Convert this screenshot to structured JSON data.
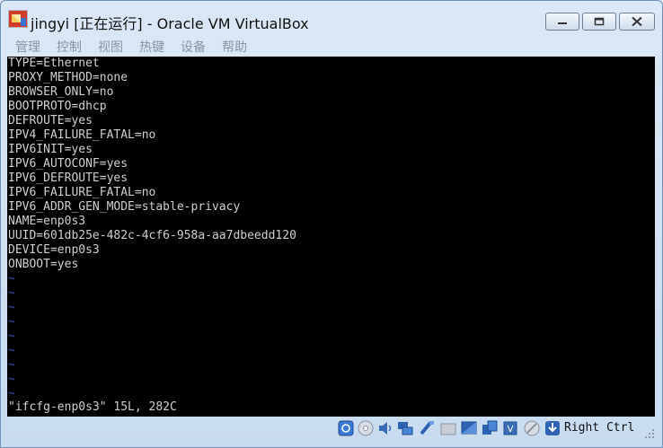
{
  "window": {
    "title": "jingyi [正在运行] - Oracle VM VirtualBox"
  },
  "menu": [
    {
      "label": "管理"
    },
    {
      "label": "控制"
    },
    {
      "label": "视图"
    },
    {
      "label": "热键"
    },
    {
      "label": "设备"
    },
    {
      "label": "帮助"
    }
  ],
  "terminal": {
    "lines": [
      "TYPE=Ethernet",
      "PROXY_METHOD=none",
      "BROWSER_ONLY=no",
      "BOOTPROTO=dhcp",
      "DEFROUTE=yes",
      "IPV4_FAILURE_FATAL=no",
      "IPV6INIT=yes",
      "IPV6_AUTOCONF=yes",
      "IPV6_DEFROUTE=yes",
      "IPV6_FAILURE_FATAL=no",
      "IPV6_ADDR_GEN_MODE=stable-privacy",
      "NAME=enp0s3",
      "UUID=601db25e-482c-4cf6-958a-aa7dbeedd120",
      "DEVICE=enp0s3",
      "ONBOOT=yes"
    ],
    "tildes": [
      "~",
      "~",
      "~",
      "~",
      "~",
      "~",
      "~",
      "~",
      "~"
    ],
    "status": "\"ifcfg-enp0s3\" 15L, 282C"
  },
  "statusbar": {
    "icons": [
      "hard-disk-icon",
      "optical-drive-icon",
      "audio-icon",
      "network-icon",
      "usb-icon",
      "shared-folder-icon",
      "display-icon",
      "video-capture-icon",
      "cpu-virtualization-icon",
      "mouse-integration-icon",
      "download-arrow-icon"
    ],
    "host_key": "Right Ctrl"
  },
  "colors": {
    "screen_bg": "#000000",
    "text": "#cfcfcf",
    "tilde": "#2d4ab0",
    "menu_disabled": "#8795a6"
  }
}
